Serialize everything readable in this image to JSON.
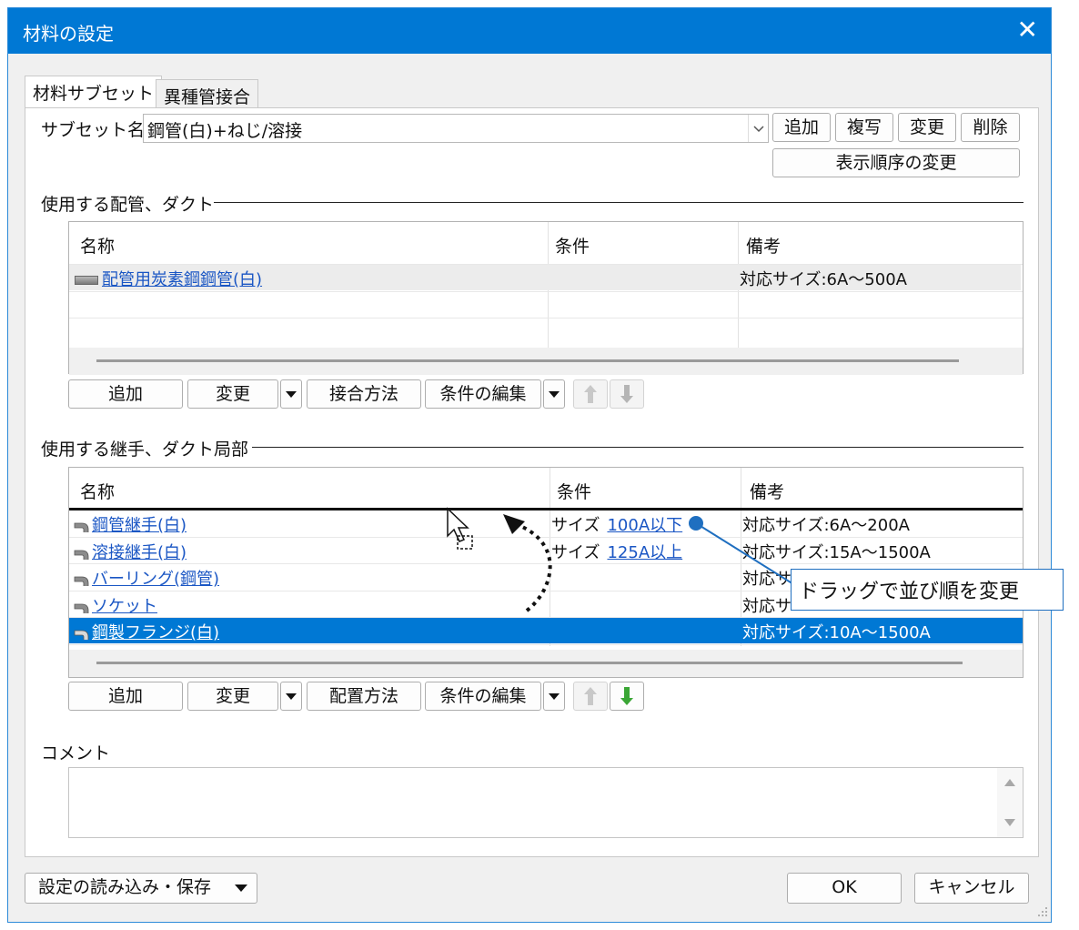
{
  "window": {
    "title": "材料の設定",
    "close_icon": "✕"
  },
  "tabs": [
    {
      "label": "材料サブセット"
    },
    {
      "label": "異種管接合"
    }
  ],
  "subset": {
    "label": "サブセット名",
    "value": "鋼管(白)+ねじ/溶接",
    "buttons": {
      "add": "追加",
      "copy": "複写",
      "change": "変更",
      "delete": "削除",
      "order": "表示順序の変更"
    }
  },
  "pipes": {
    "section_title": "使用する配管、ダクト",
    "columns": [
      "名称",
      "条件",
      "備考"
    ],
    "rows": [
      {
        "name": "配管用炭素鋼鋼管(白)",
        "cond": "",
        "note": "対応サイズ:6A〜500A"
      }
    ],
    "buttons": {
      "add": "追加",
      "change": "変更",
      "join": "接合方法",
      "edit_cond": "条件の編集"
    }
  },
  "fittings": {
    "section_title": "使用する継手、ダクト局部",
    "columns": [
      "名称",
      "条件",
      "備考"
    ],
    "rows": [
      {
        "name": "鋼管継手(白)",
        "cond_prefix": "サイズ",
        "cond_link": "100A以下",
        "note": "対応サイズ:6A〜200A"
      },
      {
        "name": "溶接継手(白)",
        "cond_prefix": "サイズ",
        "cond_link": "125A以上",
        "note": "対応サイズ:15A〜1500A"
      },
      {
        "name": "バーリング(鋼管)",
        "cond_prefix": "",
        "cond_link": "",
        "note": "対応サ"
      },
      {
        "name": "ソケット",
        "cond_prefix": "",
        "cond_link": "",
        "note": "対応サ"
      },
      {
        "name": "鋼製フランジ(白)",
        "cond_prefix": "",
        "cond_link": "",
        "note": "対応サイズ:10A〜1500A"
      }
    ],
    "selected_row": 4,
    "buttons": {
      "add": "追加",
      "change": "変更",
      "place": "配置方法",
      "edit_cond": "条件の編集"
    }
  },
  "tooltip": "ドラッグで並び順を変更",
  "comment": {
    "label": "コメント",
    "value": ""
  },
  "footer": {
    "load_save": "設定の読み込み・保存",
    "ok": "OK",
    "cancel": "キャンセル"
  },
  "icons": {
    "dropdown": "chevron-down-icon",
    "up": "arrow-up-icon",
    "down": "arrow-down-icon"
  },
  "colors": {
    "title_bar": "#0078d4",
    "link": "#1a56c4",
    "selection": "#0078d4",
    "down_arrow_enabled": "#3aa635"
  }
}
